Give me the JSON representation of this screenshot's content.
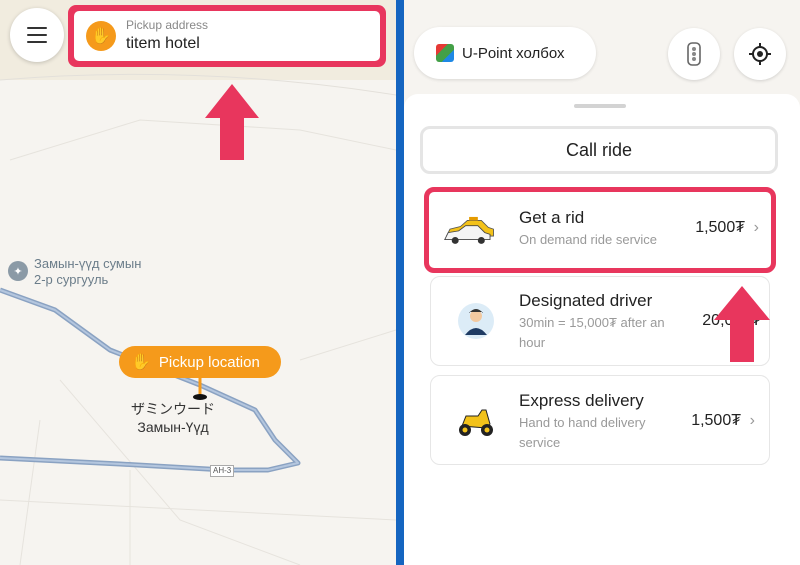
{
  "left": {
    "pickup_address": {
      "caption": "Pickup address",
      "value": "titem hotel"
    },
    "school_label": {
      "line1": "Замын-үүд сумын",
      "line2": "2-р сургууль"
    },
    "pickup_pill": "Pickup location",
    "town_label": {
      "line1": "ザミンウード",
      "line2": "Замын-Үүд"
    },
    "road_badge": "AH-3"
  },
  "right": {
    "upoint_label": "U-Point холбох",
    "call_ride_label": "Call ride",
    "services": [
      {
        "title": "Get a rid",
        "subtitle": "On demand ride service",
        "price": "1,500₮"
      },
      {
        "title": "Designated driver",
        "subtitle": "30min = 15,000₮ after an hour",
        "price": "20,000₮"
      },
      {
        "title": "Express delivery",
        "subtitle": "Hand to hand delivery service",
        "price": "1,500₮"
      }
    ]
  },
  "icons": {
    "menu": "hamburger-icon",
    "pickup": "waving-hand-icon",
    "traffic": "traffic-light-icon",
    "locate": "crosshair-icon",
    "chevron": "chevron-right-icon"
  },
  "colors": {
    "highlight": "#e8365d",
    "accent": "#f59a1b",
    "divider": "#1565c0"
  }
}
